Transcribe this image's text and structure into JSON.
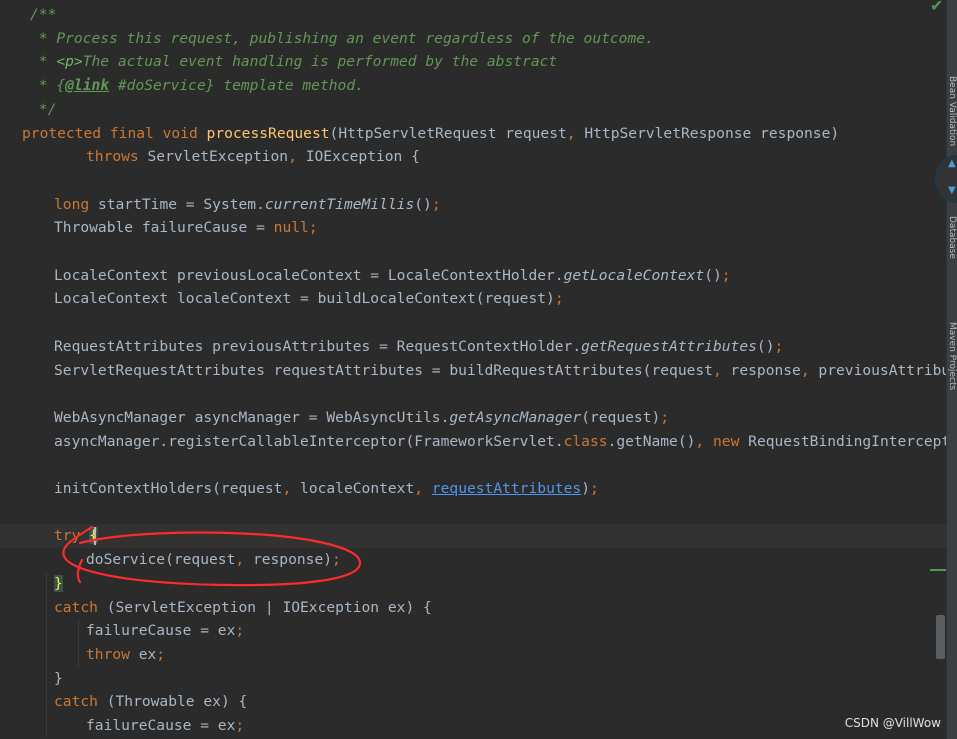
{
  "editor": {
    "language": "java",
    "caret_line": 22,
    "lines": [
      {
        "indent": 1,
        "tokens": [
          {
            "t": "/**",
            "c": "doc"
          }
        ]
      },
      {
        "indent": 1,
        "tokens": [
          {
            "t": " * Process this request, publishing an event regardless of the outcome.",
            "c": "doc"
          }
        ]
      },
      {
        "indent": 1,
        "tokens": [
          {
            "t": " * ",
            "c": "doc"
          },
          {
            "t": "<p>",
            "c": "doc-html"
          },
          {
            "t": "The actual event handling is performed by the abstract",
            "c": "doc"
          }
        ]
      },
      {
        "indent": 1,
        "tokens": [
          {
            "t": " * {",
            "c": "doc"
          },
          {
            "t": "@link",
            "c": "doc-tag"
          },
          {
            "t": " #doService} template method.",
            "c": "doc"
          }
        ]
      },
      {
        "indent": 1,
        "tokens": [
          {
            "t": " */",
            "c": "doc"
          }
        ]
      },
      {
        "indent": 0,
        "tokens": [
          {
            "t": "protected ",
            "c": "kw"
          },
          {
            "t": "final ",
            "c": "kw"
          },
          {
            "t": "void ",
            "c": "kw"
          },
          {
            "t": "processRequest",
            "c": "fn"
          },
          {
            "t": "(HttpServletRequest request",
            "c": ""
          },
          {
            "t": ", ",
            "c": "kw"
          },
          {
            "t": "HttpServletResponse response)",
            "c": ""
          }
        ]
      },
      {
        "indent": 8,
        "tokens": [
          {
            "t": "throws ",
            "c": "kw"
          },
          {
            "t": "ServletException",
            "c": ""
          },
          {
            "t": ", ",
            "c": "kw"
          },
          {
            "t": "IOException {",
            "c": ""
          }
        ]
      },
      {
        "indent": 0,
        "tokens": []
      },
      {
        "indent": 4,
        "tokens": [
          {
            "t": "long ",
            "c": "kw"
          },
          {
            "t": "startTime = System.",
            "c": ""
          },
          {
            "t": "currentTimeMillis",
            "c": "it"
          },
          {
            "t": "()",
            "c": ""
          },
          {
            "t": ";",
            "c": "kw"
          }
        ]
      },
      {
        "indent": 4,
        "tokens": [
          {
            "t": "Throwable failureCause = ",
            "c": ""
          },
          {
            "t": "null",
            "c": "kw"
          },
          {
            "t": ";",
            "c": "kw"
          }
        ]
      },
      {
        "indent": 0,
        "tokens": []
      },
      {
        "indent": 4,
        "tokens": [
          {
            "t": "LocaleContext previousLocaleContext = LocaleContextHolder.",
            "c": ""
          },
          {
            "t": "getLocaleContext",
            "c": "it"
          },
          {
            "t": "()",
            "c": ""
          },
          {
            "t": ";",
            "c": "kw"
          }
        ]
      },
      {
        "indent": 4,
        "tokens": [
          {
            "t": "LocaleContext localeContext = buildLocaleContext(request)",
            "c": ""
          },
          {
            "t": ";",
            "c": "kw"
          }
        ]
      },
      {
        "indent": 0,
        "tokens": []
      },
      {
        "indent": 4,
        "tokens": [
          {
            "t": "RequestAttributes previousAttributes = RequestContextHolder.",
            "c": ""
          },
          {
            "t": "getRequestAttributes",
            "c": "it"
          },
          {
            "t": "()",
            "c": ""
          },
          {
            "t": ";",
            "c": "kw"
          }
        ]
      },
      {
        "indent": 4,
        "tokens": [
          {
            "t": "ServletRequestAttributes requestAttributes = buildRequestAttributes(request",
            "c": ""
          },
          {
            "t": ", ",
            "c": "kw"
          },
          {
            "t": "response",
            "c": ""
          },
          {
            "t": ", ",
            "c": "kw"
          },
          {
            "t": "previousAttributes)",
            "c": ""
          },
          {
            "t": ";",
            "c": "kw"
          }
        ]
      },
      {
        "indent": 0,
        "tokens": []
      },
      {
        "indent": 4,
        "tokens": [
          {
            "t": "WebAsyncManager asyncManager = WebAsyncUtils.",
            "c": ""
          },
          {
            "t": "getAsyncManager",
            "c": "it"
          },
          {
            "t": "(request)",
            "c": ""
          },
          {
            "t": ";",
            "c": "kw"
          }
        ]
      },
      {
        "indent": 4,
        "tokens": [
          {
            "t": "asyncManager.registerCallableInterceptor(FrameworkServlet.",
            "c": ""
          },
          {
            "t": "class",
            "c": "kw"
          },
          {
            "t": ".getName()",
            "c": ""
          },
          {
            "t": ", ",
            "c": "kw"
          },
          {
            "t": "new ",
            "c": "kw"
          },
          {
            "t": "RequestBindingInterceptor())",
            "c": ""
          },
          {
            "t": ";",
            "c": "kw"
          }
        ]
      },
      {
        "indent": 0,
        "tokens": []
      },
      {
        "indent": 4,
        "tokens": [
          {
            "t": "initContextHolders(request",
            "c": ""
          },
          {
            "t": ", ",
            "c": "kw"
          },
          {
            "t": "localeContext",
            "c": ""
          },
          {
            "t": ", ",
            "c": "kw"
          },
          {
            "t": "requestAttributes",
            "c": "link"
          },
          {
            "t": ")",
            "c": ""
          },
          {
            "t": ";",
            "c": "kw"
          }
        ]
      },
      {
        "indent": 0,
        "tokens": []
      },
      {
        "indent": 4,
        "tokens": [
          {
            "t": "try ",
            "c": "kw"
          },
          {
            "t": "{",
            "c": "brace-match"
          }
        ]
      },
      {
        "indent": 8,
        "tokens": [
          {
            "t": "doService(request",
            "c": ""
          },
          {
            "t": ", ",
            "c": "kw"
          },
          {
            "t": "response)",
            "c": ""
          },
          {
            "t": ";",
            "c": "kw"
          }
        ]
      },
      {
        "indent": 4,
        "tokens": [
          {
            "t": "}",
            "c": "brace-match"
          }
        ]
      },
      {
        "indent": 4,
        "tokens": [
          {
            "t": "catch ",
            "c": "kw"
          },
          {
            "t": "(ServletException | IOException ex) {",
            "c": ""
          }
        ]
      },
      {
        "indent": 8,
        "tokens": [
          {
            "t": "failureCause = ex",
            "c": ""
          },
          {
            "t": ";",
            "c": "kw"
          }
        ]
      },
      {
        "indent": 8,
        "tokens": [
          {
            "t": "throw ",
            "c": "kw"
          },
          {
            "t": "ex",
            "c": ""
          },
          {
            "t": ";",
            "c": "kw"
          }
        ]
      },
      {
        "indent": 4,
        "tokens": [
          {
            "t": "}",
            "c": ""
          }
        ]
      },
      {
        "indent": 4,
        "tokens": [
          {
            "t": "catch ",
            "c": "kw"
          },
          {
            "t": "(Throwable ex) {",
            "c": ""
          }
        ]
      },
      {
        "indent": 8,
        "tokens": [
          {
            "t": "failureCause = ex",
            "c": ""
          },
          {
            "t": ";",
            "c": "kw"
          }
        ]
      }
    ]
  },
  "side_panel": {
    "labels": [
      "Bean Validation",
      "Database",
      "Maven Projects"
    ]
  },
  "watermark": "CSDN @VillWow",
  "colors": {
    "background": "#2b2b2b",
    "keyword": "#cc7832",
    "function": "#ffc66d",
    "doc_comment": "#629755",
    "link": "#5394ec",
    "annotation": "#ff2a2a"
  }
}
